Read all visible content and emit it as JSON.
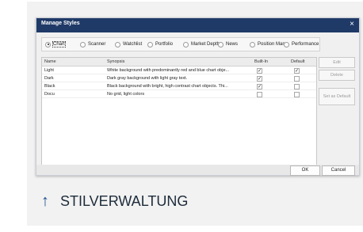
{
  "dialog": {
    "title": "Manage Styles",
    "close_glyph": "×",
    "radios": [
      "Chart",
      "Scanner",
      "Watchlist",
      "Portfolio",
      "Market Depth",
      "News",
      "Position Man",
      "Performance"
    ],
    "selected_radio": "Chart",
    "columns": [
      "Name",
      "Synopsis",
      "Built-In",
      "Default"
    ],
    "rows": [
      {
        "name": "Light",
        "synopsis": "White background with predominantly red and blue chart obje...",
        "builtin": "✓",
        "default": "✓"
      },
      {
        "name": "Dark",
        "synopsis": "Dark gray background with light gray text.",
        "builtin": "✓",
        "default": ""
      },
      {
        "name": "Black",
        "synopsis": "Black background with bright, high contrast chart objects. Thi...",
        "builtin": "✓",
        "default": ""
      },
      {
        "name": "Docu",
        "synopsis": "No grid, light colors",
        "builtin": "",
        "default": ""
      }
    ],
    "side_buttons": {
      "edit": "Edit",
      "delete": "Delete",
      "set_default": "Set as Default"
    },
    "footer": {
      "ok": "OK",
      "cancel": "Cancel"
    }
  },
  "caption": {
    "icon": "arrow-up-icon",
    "glyph": "↑",
    "text": "STILVERWALTUNG"
  }
}
